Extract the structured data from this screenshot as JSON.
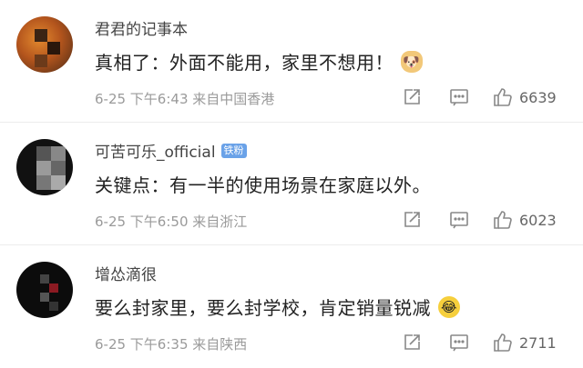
{
  "comments": [
    {
      "username": "君君的记事本",
      "badge": "",
      "text": "真相了：外面不能用，家里不想用！",
      "emoji": "dog-emoji",
      "meta": "6-25 下午6:43 来自中国香港",
      "likes": "6639"
    },
    {
      "username": "可苦可乐_official",
      "badge": "铁粉",
      "text": "关键点：有一半的使用场景在家庭以外。",
      "emoji": "",
      "meta": "6-25 下午6:50 来自浙江",
      "likes": "6023"
    },
    {
      "username": "增怂滴很",
      "badge": "",
      "text": "要么封家里，要么封学校，肯定销量锐减",
      "emoji": "laugh-cry-emoji",
      "meta": "6-25 下午6:35 来自陕西",
      "likes": "2711"
    }
  ]
}
